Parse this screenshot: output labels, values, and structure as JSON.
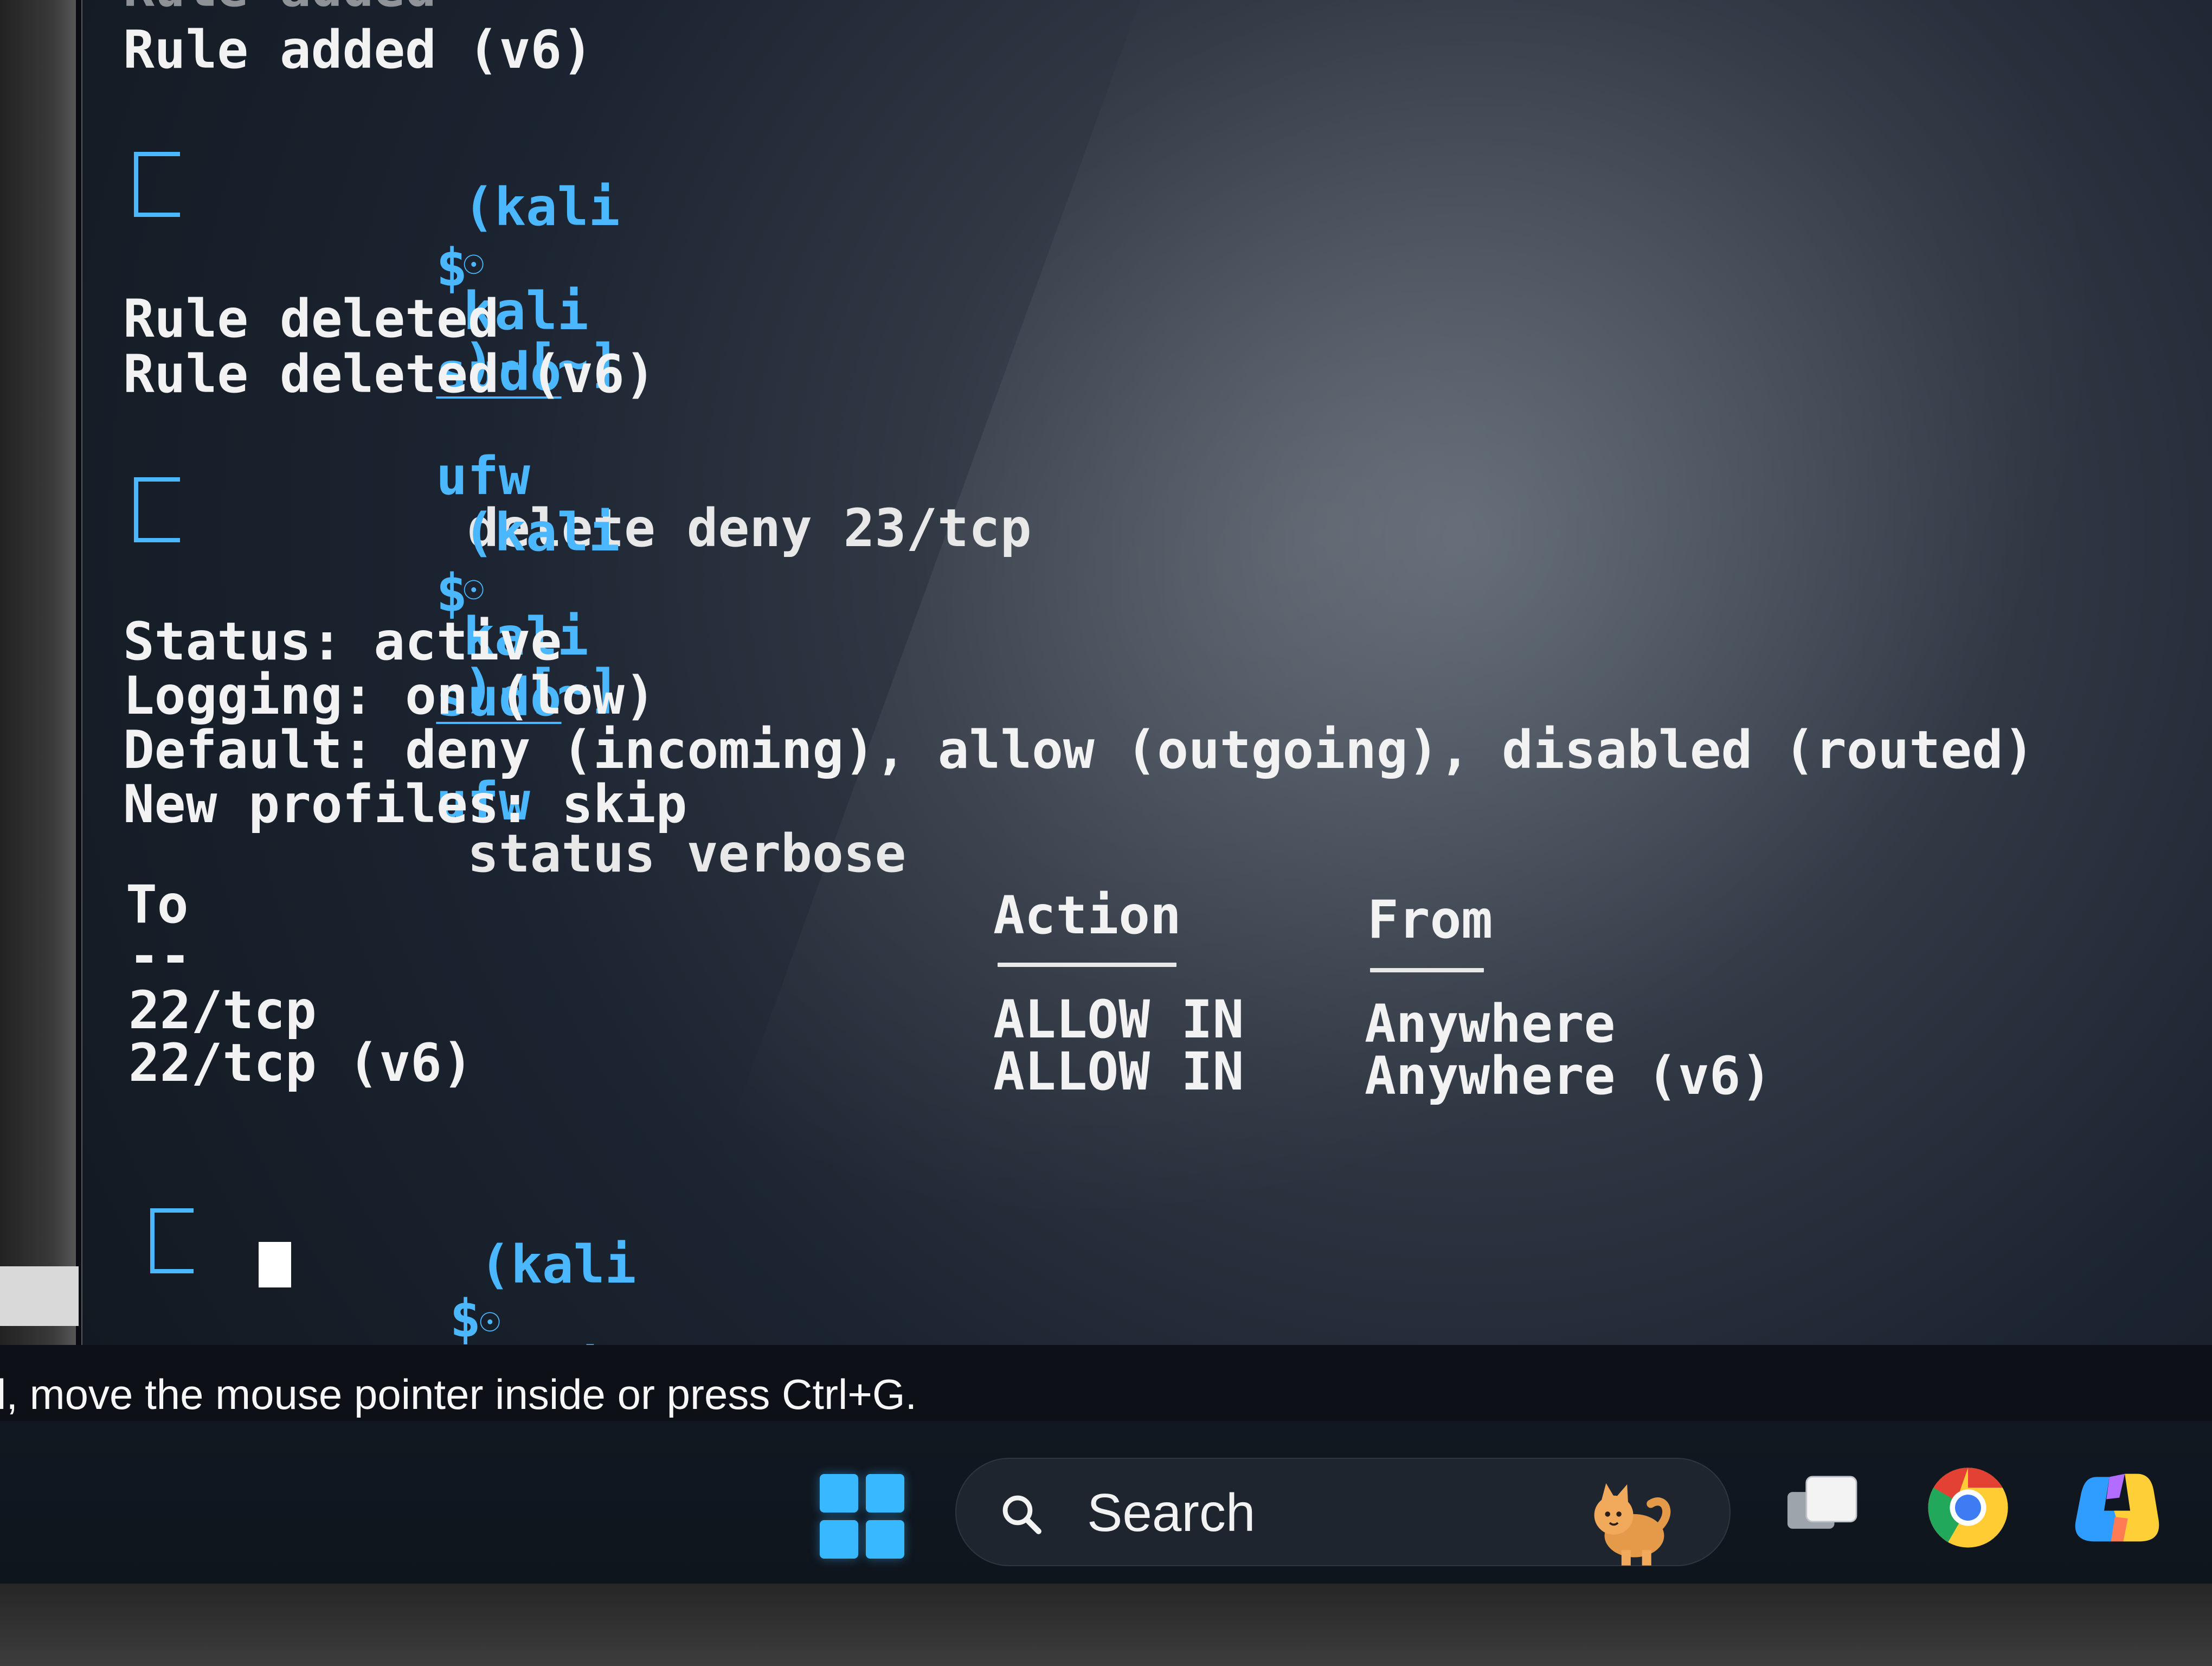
{
  "terminal": {
    "line_prev_fragment": "Rule added",
    "line_rule_added_v6": "Rule added (v6)",
    "prompt_user": "(kali",
    "prompt_host": "kali",
    "prompt_path": ")-[~]",
    "prompt_dollar": "$",
    "command1": {
      "sudo": "sudo",
      "ufw": "ufw",
      "rest": " delete deny 23/tcp"
    },
    "rule_deleted": "Rule deleted",
    "rule_deleted_v6": "Rule deleted (v6)",
    "command2": {
      "sudo": "sudo",
      "ufw": "ufw",
      "rest": " status verbose"
    },
    "status_lines": [
      "Status: active",
      "Logging: on (low)",
      "Default: deny (incoming), allow (outgoing), disabled (routed)",
      "New profiles: skip"
    ],
    "table": {
      "headers": [
        "To",
        "Action",
        "From"
      ],
      "to_separator": "--",
      "rows": [
        [
          "22/tcp",
          "ALLOW IN",
          "Anywhere"
        ],
        [
          "22/tcp (v6)",
          "ALLOW IN",
          "Anywhere (v6)"
        ]
      ]
    }
  },
  "status_bar": {
    "text": "l, move the mouse pointer inside or press Ctrl+G."
  },
  "taskbar": {
    "search_label": "Search",
    "icons": [
      "windows-start-icon",
      "search-icon",
      "cat-icon",
      "task-view-icon",
      "chrome-icon",
      "copilot-icon"
    ]
  },
  "colors": {
    "prompt_blue": "#4bb7ff",
    "terminal_bg": "#1b2430",
    "taskbar_bg": "#111821"
  }
}
